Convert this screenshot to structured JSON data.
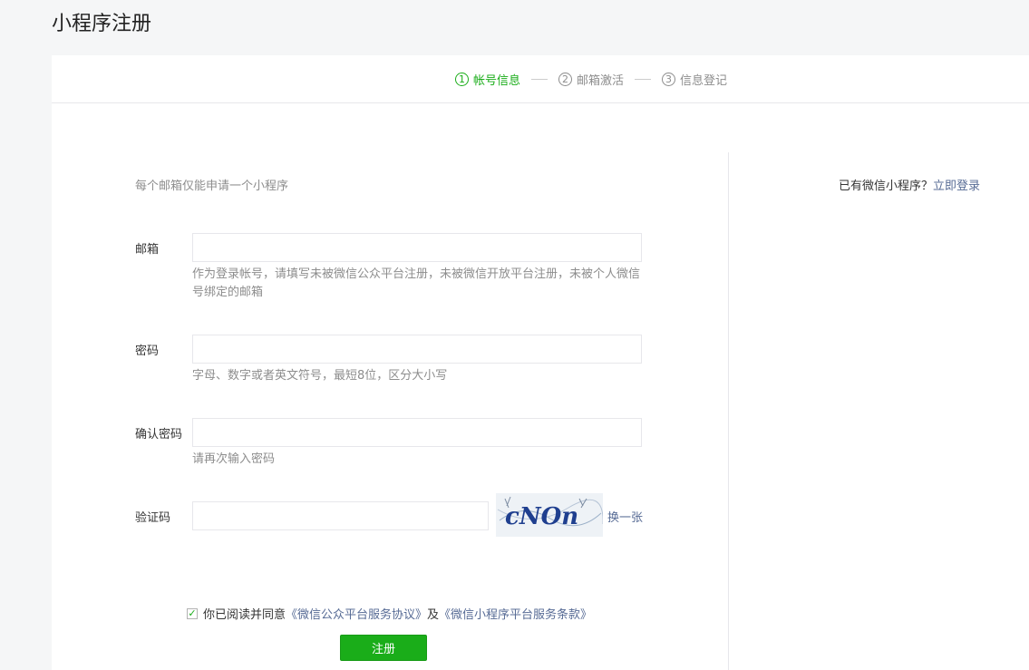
{
  "page": {
    "title": "小程序注册"
  },
  "steps": [
    {
      "num": "1",
      "label": "帐号信息",
      "active": true
    },
    {
      "num": "2",
      "label": "邮箱激活",
      "active": false
    },
    {
      "num": "3",
      "label": "信息登记",
      "active": false
    }
  ],
  "form": {
    "tip": "每个邮箱仅能申请一个小程序",
    "email": {
      "label": "邮箱",
      "value": "",
      "hint": "作为登录帐号，请填写未被微信公众平台注册，未被微信开放平台注册，未被个人微信号绑定的邮箱"
    },
    "password": {
      "label": "密码",
      "value": "",
      "hint": "字母、数字或者英文符号，最短8位，区分大小写"
    },
    "confirm": {
      "label": "确认密码",
      "value": "",
      "hint": "请再次输入密码"
    },
    "captcha": {
      "label": "验证码",
      "value": "",
      "image_text": "cNOn",
      "refresh_label": "换一张"
    }
  },
  "login_tip": {
    "text": "已有微信小程序？",
    "link": "立即登录"
  },
  "agreement": {
    "checked": true,
    "prefix": "你已阅读并同意",
    "link1": "《微信公众平台服务协议》",
    "middle": "及",
    "link2": "《微信小程序平台服务条款》"
  },
  "register_button": {
    "label": "注册"
  },
  "colors": {
    "accent": "#1aad19",
    "link": "#576b95",
    "hint": "#8d8d8d",
    "border": "#e7e7eb"
  }
}
